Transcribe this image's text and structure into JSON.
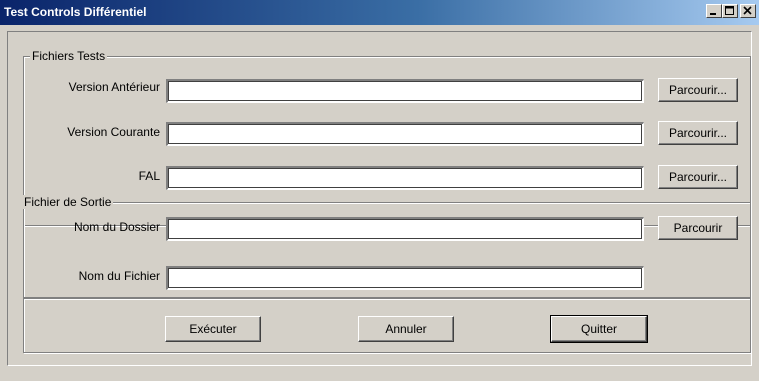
{
  "window": {
    "title": "Test Controls Différentiel",
    "minimize_glyph": "minimize-icon",
    "maximize_glyph": "maximize-icon",
    "close_glyph": "close-icon"
  },
  "fichiers_tests": {
    "group_label": "Fichiers Tests",
    "version_anterieur": {
      "label": "Version Antérieur",
      "value": "",
      "browse_label": "Parcourir..."
    },
    "version_courante": {
      "label": "Version Courante",
      "value": "",
      "browse_label": "Parcourir..."
    },
    "fal": {
      "label": "FAL",
      "value": "",
      "browse_label": "Parcourir..."
    }
  },
  "fichier_de_sortie": {
    "group_label": "Fichier de Sortie",
    "nom_dossier": {
      "label": "Nom du Dossier",
      "value": "",
      "browse_label": "Parcourir"
    },
    "nom_fichier": {
      "label": "Nom du Fichier",
      "value": ""
    }
  },
  "actions": {
    "executer": "Exécuter",
    "annuler": "Annuler",
    "quitter": "Quitter"
  }
}
